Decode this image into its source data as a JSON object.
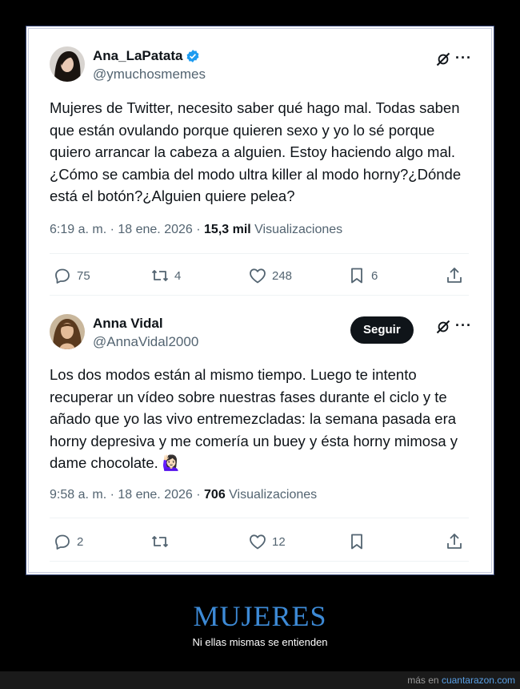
{
  "tweets": [
    {
      "name": "Ana_LaPatata",
      "handle": "@ymuchosmemes",
      "verified": true,
      "text": "Mujeres de Twitter, necesito saber qué hago mal. Todas saben que están ovulando porque quieren sexo y yo lo sé porque quiero arrancar la cabeza a alguien. Estoy haciendo algo mal. ¿Cómo se cambia del modo ultra killer al modo horny?¿Dónde está el botón?¿Alguien quiere pelea?",
      "time": "6:19 a. m. · 18 ene. 2026 · ",
      "views": "15,3 mil",
      "views_label": " Visualizaciones",
      "replies": "75",
      "retweets": "4",
      "likes": "248",
      "bookmarks": "6",
      "more": "···"
    },
    {
      "name": "Anna Vidal",
      "handle": "@AnnaVidal2000",
      "follow_label": "Seguir",
      "text": "Los dos modos están al mismo tiempo. Luego te intento recuperar un vídeo sobre nuestras fases durante el ciclo y te añado que yo las vivo  entremezcladas: la semana pasada era horny depresiva y me comería un buey y ésta horny mimosa y dame chocolate. 🙋🏻‍♀️",
      "time": "9:58 a. m. · 18 ene. 2026 · ",
      "views": "706",
      "views_label": " Visualizaciones",
      "replies": "2",
      "retweets": "",
      "likes": "12",
      "bookmarks": "",
      "more": "···"
    }
  ],
  "caption": {
    "title": "MUJERES",
    "subtitle": "Ni ellas mismas se entienden"
  },
  "footer": {
    "prefix": "más en ",
    "site": "cuantarazon.com"
  },
  "colors": {
    "accent": "#1d9bf0",
    "title": "#3d8ad6"
  }
}
